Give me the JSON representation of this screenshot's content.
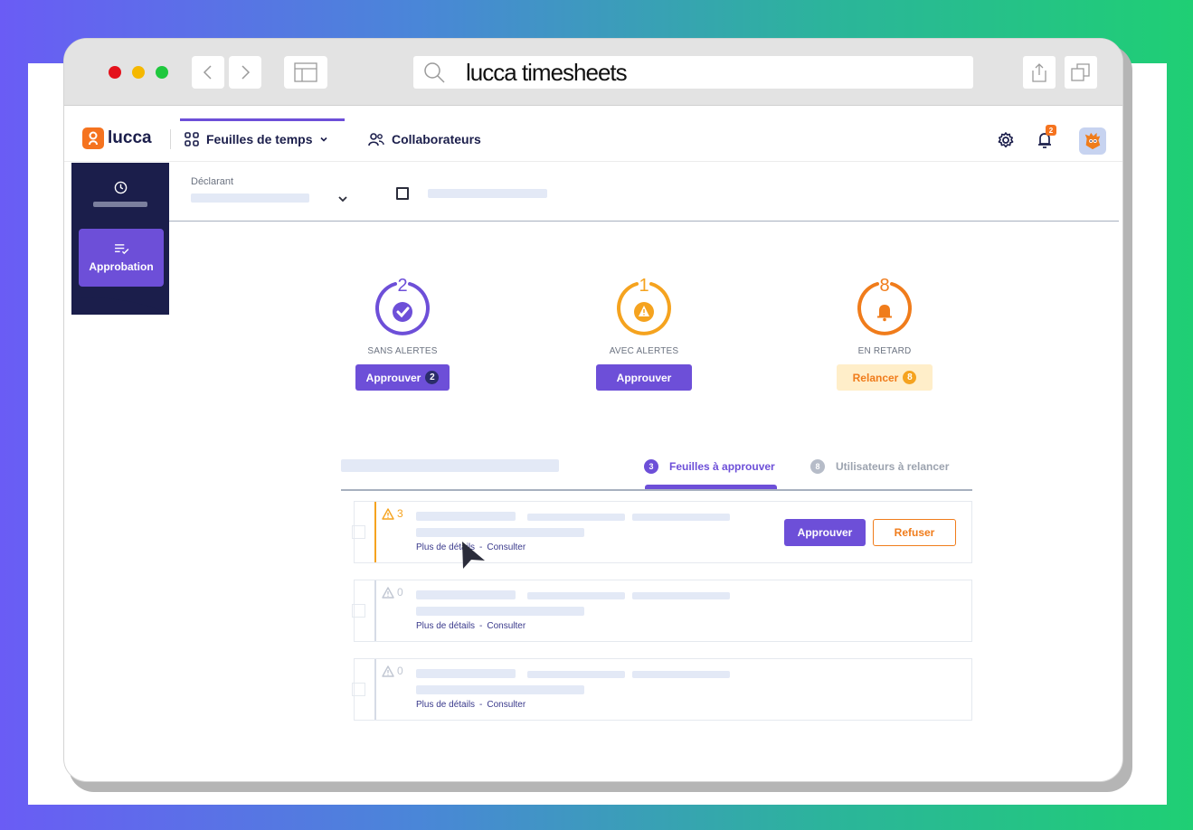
{
  "browser": {
    "url": "lucca timesheets"
  },
  "app": {
    "logo_text": "lucca",
    "nav": {
      "timesheets_label": "Feuilles de temps",
      "collaborators_label": "Collaborateurs"
    },
    "notifications_count": "2"
  },
  "sidebar": {
    "approval_label": "Approbation"
  },
  "filters": {
    "declarant_label": "Déclarant"
  },
  "stats": [
    {
      "count": "2",
      "caption": "SANS ALERTES",
      "button_label": "Approuver",
      "button_count": "2",
      "color": "#6d4fd8"
    },
    {
      "count": "1",
      "caption": "AVEC ALERTES",
      "button_label": "Approuver",
      "color": "#f5a31f"
    },
    {
      "count": "8",
      "caption": "EN RETARD",
      "button_label": "Relancer",
      "button_count": "8",
      "color": "#f07c1b"
    }
  ],
  "tabs": [
    {
      "count": "3",
      "label": "Feuilles à approuver",
      "active": true
    },
    {
      "count": "8",
      "label": "Utilisateurs à relancer",
      "active": false
    }
  ],
  "rows": [
    {
      "warnings": "3",
      "details_link": "Plus de détails",
      "consult_link": "Consulter",
      "approve_label": "Approuver",
      "refuse_label": "Refuser"
    },
    {
      "warnings": "0",
      "details_link": "Plus de détails",
      "consult_link": "Consulter"
    },
    {
      "warnings": "0",
      "details_link": "Plus de détails",
      "consult_link": "Consulter"
    }
  ],
  "row_separator": "-"
}
